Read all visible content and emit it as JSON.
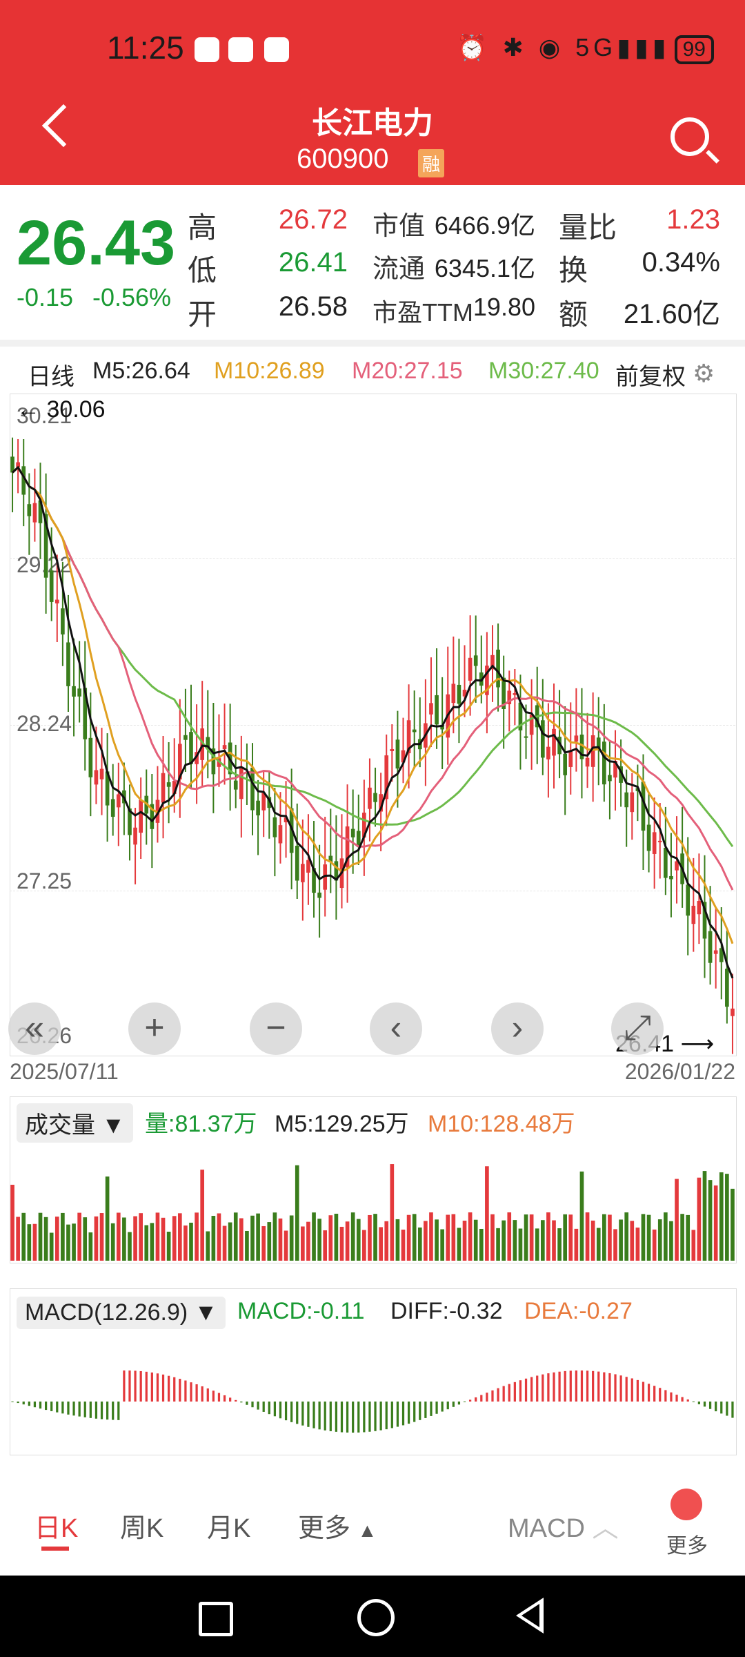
{
  "status": {
    "time": "11:25",
    "battery": "99",
    "network": "5G"
  },
  "header": {
    "title": "长江电力",
    "code": "600900",
    "badge": "融"
  },
  "quote": {
    "price": "26.43",
    "change": "-0.15",
    "change_pct": "-0.56%",
    "labels": {
      "high": "高",
      "low": "低",
      "open": "开",
      "mcap": "市值",
      "float": "流通",
      "pe": "市盈TTM",
      "vr": "量比",
      "turn": "换",
      "amt": "额"
    },
    "high": "26.72",
    "low": "26.41",
    "open": "26.58",
    "mcap": "6466.9亿",
    "float": "6345.1亿",
    "pe": "19.80",
    "vr": "1.23",
    "turn": "0.34%",
    "amt": "21.60亿"
  },
  "ma_bar": {
    "period": "日线",
    "m5": "M5:26.64",
    "m10": "M10:26.89",
    "m20": "M20:27.15",
    "m30": "M30:27.40",
    "adjust": "前复权"
  },
  "kline": {
    "y_labels": [
      "30.21",
      "29.22",
      "28.24",
      "27.25",
      "26.26"
    ],
    "max_note": "30.06",
    "min_note": "26.41",
    "start_date": "2025/07/11",
    "end_date": "2026/01/22"
  },
  "volume": {
    "selector": "成交量",
    "vol": "量:81.37万",
    "m5": "M5:129.25万",
    "m10": "M10:128.48万"
  },
  "macd": {
    "selector": "MACD(12.26.9)",
    "macd": "MACD:-0.11",
    "diff": "DIFF:-0.32",
    "dea": "DEA:-0.27"
  },
  "tabs": {
    "day": "日K",
    "week": "周K",
    "month": "月K",
    "more": "更多",
    "indicator": "MACD",
    "more2": "更多"
  },
  "colors": {
    "up": "#e4393c",
    "down": "#3a7d1c",
    "brand": "#e63334",
    "m10": "#e0a020",
    "m20": "#e4607a",
    "m30": "#6dbb4a"
  },
  "chart_data": {
    "type": "candlestick",
    "ylim": [
      26.26,
      30.21
    ],
    "date_range": [
      "2025/07/11",
      "2026/01/22"
    ],
    "anchors_close": [
      29.8,
      29.6,
      29.0,
      28.4,
      27.9,
      27.7,
      27.6,
      27.7,
      28.0,
      28.1,
      28.0,
      27.9,
      27.7,
      27.6,
      27.3,
      27.2,
      27.4,
      27.6,
      27.9,
      28.1,
      28.2,
      28.3,
      28.5,
      28.6,
      28.4,
      28.2,
      28.1,
      28.0,
      28.1,
      27.9,
      27.8,
      27.5,
      27.3,
      27.1,
      26.8,
      26.43
    ],
    "ma_last": {
      "M5": 26.64,
      "M10": 26.89,
      "M20": 27.15,
      "M30": 27.4
    },
    "volume_last": "81.37万",
    "macd_last": {
      "MACD": -0.11,
      "DIFF": -0.32,
      "DEA": -0.27
    }
  }
}
